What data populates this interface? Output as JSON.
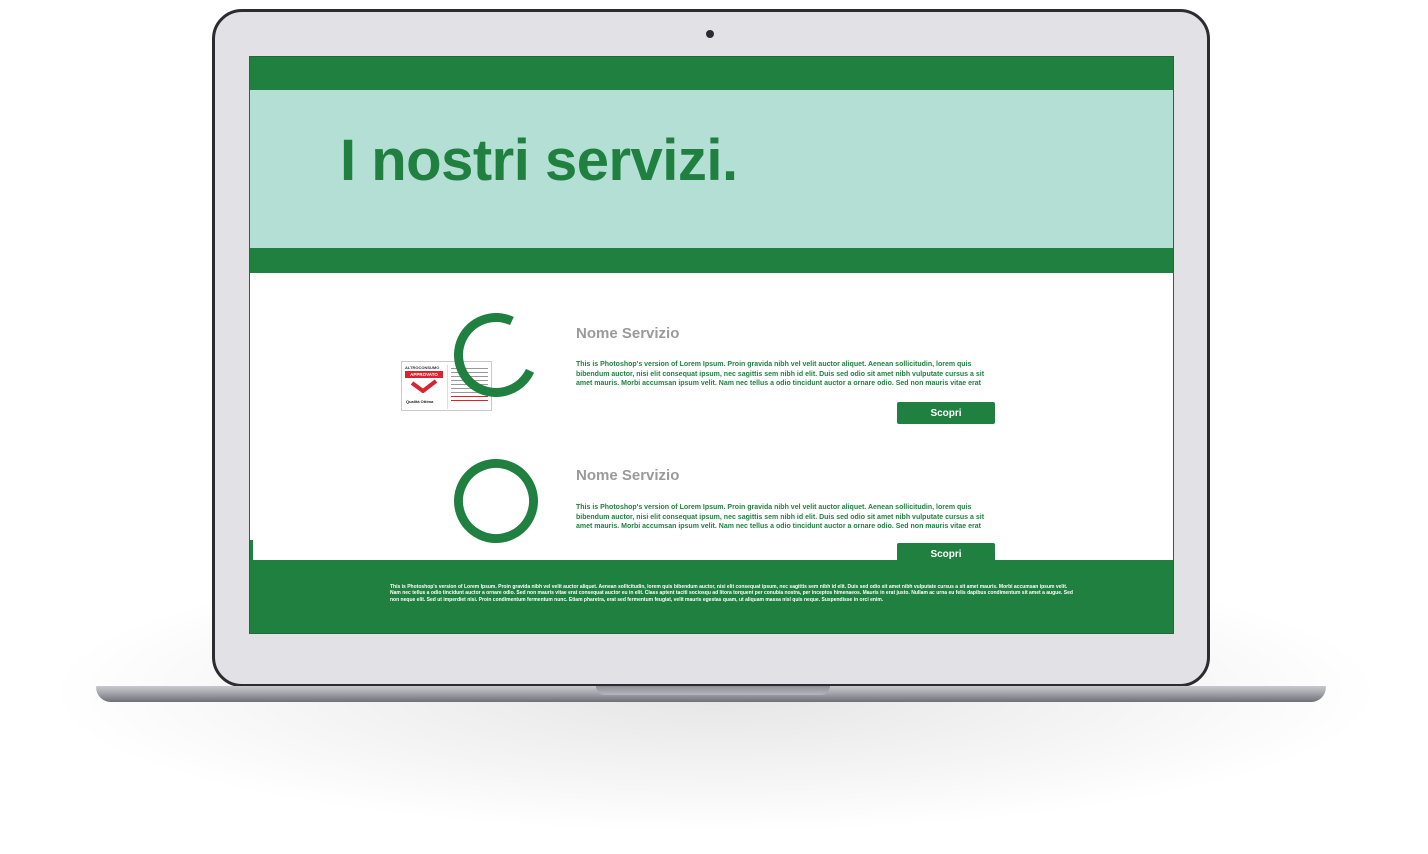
{
  "hero": {
    "title": "I nostri servizi."
  },
  "services": [
    {
      "name": "Nome Servizio",
      "description": "This is Photoshop's version  of Lorem Ipsum. Proin gravida nibh vel velit auctor aliquet. Aenean sollicitudin, lorem quis bibendum auctor, nisi elit consequat ipsum, nec sagittis sem nibh id elit. Duis sed odio sit amet nibh vulputate cursus a sit amet mauris. Morbi accumsan ipsum velit. Nam nec tellus a odio tincidunt auctor a ornare odio. Sed non  mauris vitae erat",
      "button_label": "Scopri"
    },
    {
      "name": "Nome Servizio",
      "description": "This is Photoshop's version  of Lorem Ipsum. Proin gravida nibh vel velit auctor aliquet. Aenean sollicitudin, lorem quis bibendum auctor, nisi elit consequat ipsum, nec sagittis sem nibh id elit. Duis sed odio sit amet nibh vulputate cursus a sit amet mauris. Morbi accumsan ipsum velit. Nam nec tellus a odio tincidunt auctor a ornare odio. Sed non  mauris vitae erat",
      "button_label": "Scopri"
    }
  ],
  "badge": {
    "brand": "ALTROCONSUMO",
    "status": "APPROVATO",
    "quality": "Qualità Ottima"
  },
  "footer": {
    "text": "This is Photoshop's version  of Lorem Ipsum. Proin gravida nibh vel velit auctor aliquet. Aenean sollicitudin, lorem quis bibendum auctor, nisi elit consequat ipsum, nec sagittis sem nibh id elit. Duis sed odio sit amet nibh vulputate cursus a sit amet mauris. Morbi accumsan ipsum velit. Nam nec tellus a odio tincidunt auctor a ornare odio. Sed non  mauris vitae erat consequat auctor eu in elit. Class aptent taciti sociosqu ad litora torquent per conubia nostra, per inceptos himenaeos. Mauris in erat justo. Nullam ac urna eu felis dapibus condimentum sit amet a augue. Sed non neque elit. Sed ut imperdiet nisi. Proin condimentum fermentum nunc. Etiam pharetra, erat sed fermentum feugiat, velit mauris egestas quam, ut aliquam massa nisl quis neque. Suspendisse in orci enim."
  },
  "colors": {
    "brand_green": "#1f8040",
    "hero_mint": "#b3dfd4",
    "title_gray": "#9a9a9a",
    "badge_red": "#d9232d"
  }
}
